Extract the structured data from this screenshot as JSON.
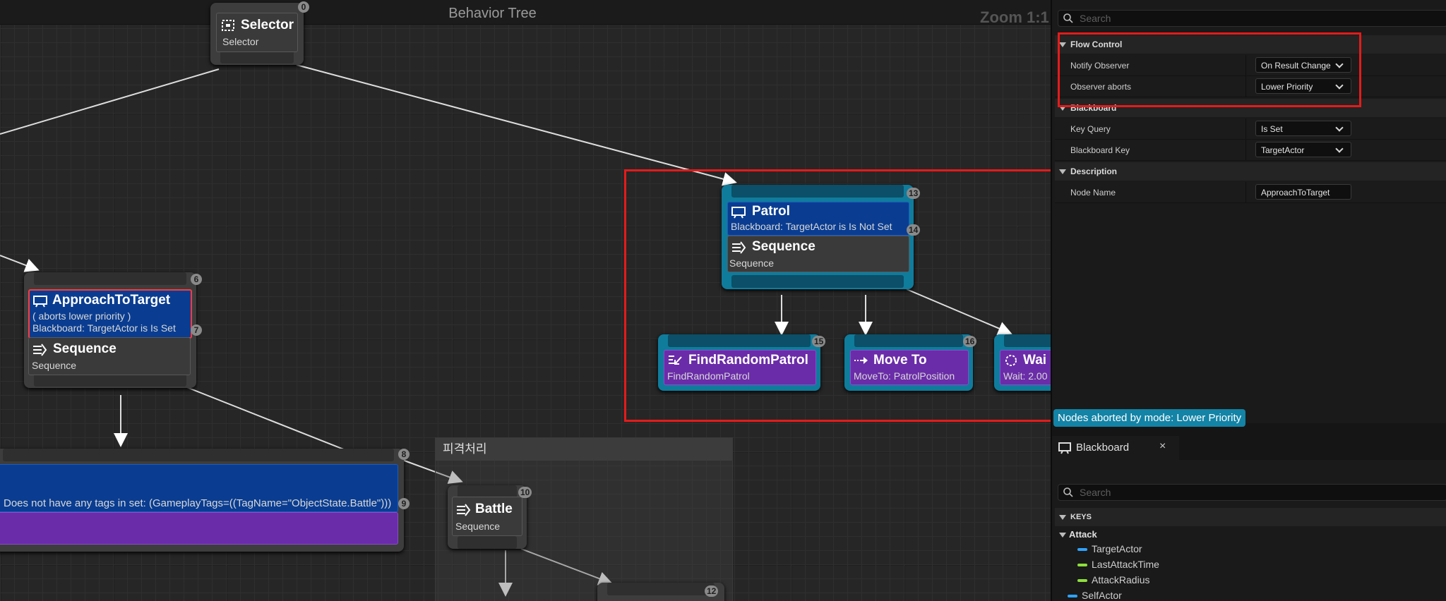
{
  "graph": {
    "title": "Behavior Tree",
    "zoom": "Zoom 1:1",
    "tooltip": "Nodes aborted by mode: Lower Priority"
  },
  "nodes": {
    "selector": {
      "title": "Selector",
      "subtitle": "Selector",
      "badge": "0"
    },
    "approach": {
      "decorator_title": "ApproachToTarget",
      "decorator_line1": "( aborts lower priority )",
      "decorator_line2": "Blackboard: TargetActor is Is Set",
      "comp_title": "Sequence",
      "comp_subtitle": "Sequence",
      "badge_node": "6",
      "badge_dec": "7"
    },
    "patrol": {
      "decorator_title": "Patrol",
      "decorator_line1": "Blackboard: TargetActor is Is Not Set",
      "comp_title": "Sequence",
      "comp_subtitle": "Sequence",
      "badge_node": "13",
      "badge_dec": "14"
    },
    "find_random": {
      "title": "FindRandomPatrol",
      "subtitle": "FindRandomPatrol",
      "badge": "15"
    },
    "move_to": {
      "title": "Move To",
      "subtitle": "MoveTo: PatrolPosition",
      "badge": "16"
    },
    "wait": {
      "title": "Wai",
      "subtitle": "Wait: 2.00"
    },
    "tags_node": {
      "line": "Does not have any tags in set: (GameplayTags=((TagName=\"ObjectState.Battle\")))",
      "badge_node": "8",
      "badge_dec": "9"
    },
    "battle": {
      "title": "Battle",
      "subtitle": "Sequence",
      "badge": "10"
    },
    "bottom_right": {
      "badge": "12"
    }
  },
  "comment_box": {
    "title": "피격처리"
  },
  "details": {
    "search_placeholder": "Search",
    "categories": {
      "flow_control": "Flow Control",
      "blackboard": "Blackboard",
      "description": "Description"
    },
    "rows": {
      "notify_observer": {
        "label": "Notify Observer",
        "value": "On Result Change"
      },
      "observer_aborts": {
        "label": "Observer aborts",
        "value": "Lower Priority"
      },
      "key_query": {
        "label": "Key Query",
        "value": "Is Set"
      },
      "blackboard_key": {
        "label": "Blackboard Key",
        "value": "TargetActor"
      },
      "node_name": {
        "label": "Node Name",
        "value": "ApproachToTarget"
      }
    }
  },
  "blackboard_panel": {
    "tab_label": "Blackboard",
    "close": "×",
    "search_placeholder": "Search",
    "keys_header": "KEYS",
    "group": "Attack",
    "keys": [
      {
        "name": "TargetActor",
        "color": "#2fa3ff"
      },
      {
        "name": "LastAttackTime",
        "color": "#8ee03a"
      },
      {
        "name": "AttackRadius",
        "color": "#8ee03a"
      },
      {
        "name": "SelfActor",
        "color": "#2fa3ff"
      }
    ]
  },
  "colors": {
    "highlight": "#e41b1b",
    "decorator": "#0a3d91",
    "task": "#6a2ca8",
    "active_node": "#0f7c9c"
  }
}
